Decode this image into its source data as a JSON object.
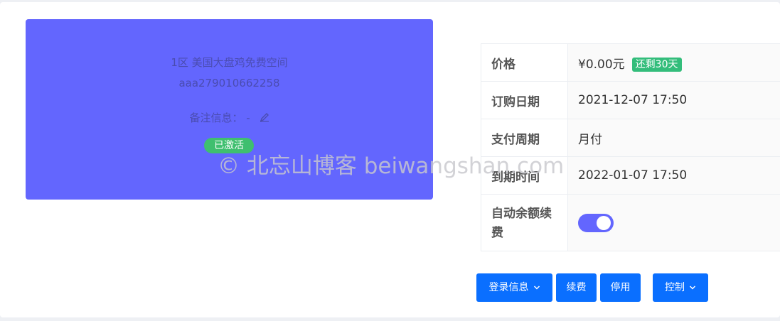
{
  "product": {
    "title": "1区 美国大盘鸡免费空间",
    "account": "aaa279010662258",
    "remark_label": "备注信息：",
    "remark_value": "-",
    "status": "已激活"
  },
  "watermark": "© 北忘山博客 beiwangshan.com",
  "details": {
    "price_label": "价格",
    "price_value": "¥0.00元",
    "remaining_badge": "还剩30天",
    "order_date_label": "订购日期",
    "order_date_value": "2021-12-07 17:50",
    "pay_cycle_label": "支付周期",
    "pay_cycle_value": "月付",
    "expire_label": "到期时间",
    "expire_value": "2022-01-07 17:50",
    "auto_renew_label": "自动余额续费",
    "auto_renew_enabled": true
  },
  "actions": {
    "login_info": "登录信息",
    "renew": "续费",
    "disable": "停用",
    "control": "控制"
  },
  "colors": {
    "card": "#6366fe",
    "button": "#0a6fff",
    "active_pill": "#3fbf6f",
    "days_badge": "#33bd7b"
  },
  "icons": {
    "edit": "pencil-icon",
    "dropdown": "chevron-down-icon"
  }
}
